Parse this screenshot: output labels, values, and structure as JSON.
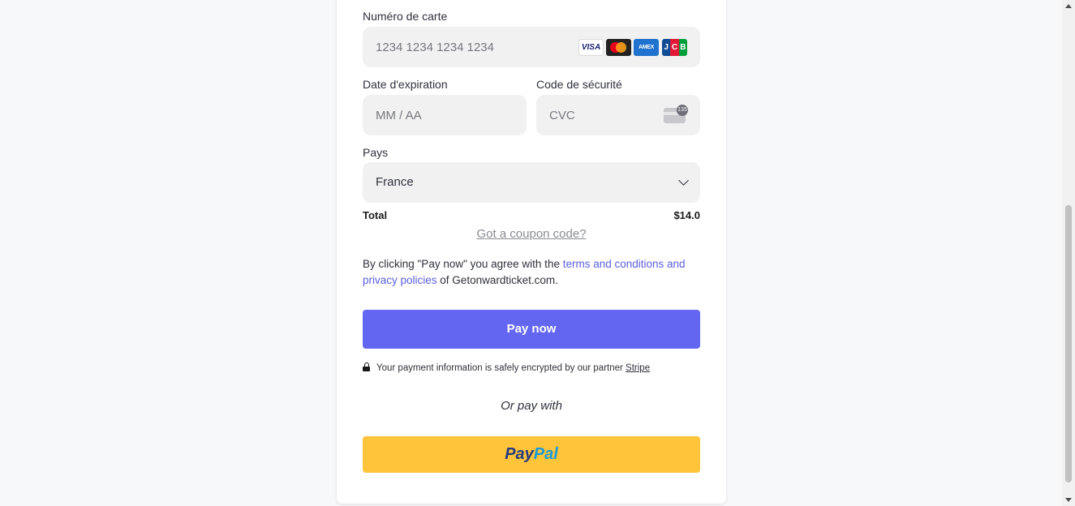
{
  "card_number": {
    "label": "Numéro de carte",
    "placeholder": "1234 1234 1234 1234",
    "brands": {
      "visa": "VISA",
      "mastercard": "mastercard",
      "amex": "AMEX",
      "jcb": [
        "J",
        "C",
        "B"
      ]
    }
  },
  "expiry": {
    "label": "Date d'expiration",
    "placeholder": "MM / AA"
  },
  "cvc": {
    "label": "Code de sécurité",
    "placeholder": "CVC",
    "badge": "135"
  },
  "country": {
    "label": "Pays",
    "value": "France"
  },
  "total": {
    "label": "Total",
    "value": "$14.0"
  },
  "coupon_link": "Got a coupon code?",
  "terms": {
    "prefix": "By clicking \"Pay now\" you agree with the ",
    "link": "terms and conditions and privacy policies",
    "suffix": " of Getonwardticket.com."
  },
  "pay_button": "Pay now",
  "secure_note": {
    "text": "Your payment information is safely encrypted by our partner ",
    "partner": "Stripe"
  },
  "or_pay_with": "Or pay with",
  "paypal": {
    "part1": "Pay",
    "part2": "Pal"
  },
  "colors": {
    "accent": "#6366f1",
    "paypal_button": "#ffc43a",
    "field_bg": "#f1f1f1"
  }
}
